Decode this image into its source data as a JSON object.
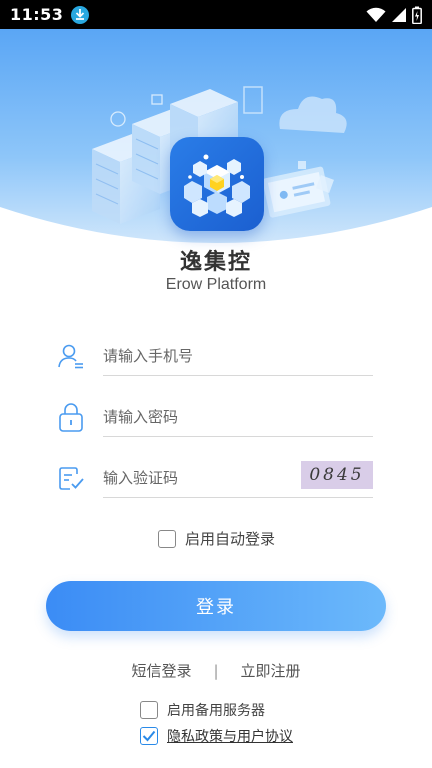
{
  "status_bar": {
    "time": "11:53"
  },
  "app": {
    "title": "逸集控",
    "subtitle": "Erow Platform"
  },
  "form": {
    "phone_placeholder": "请输入手机号",
    "password_placeholder": "请输入密码",
    "code_placeholder": "输入验证码",
    "captcha_text": "0845",
    "auto_login_label": "启用自动登录",
    "auto_login_checked": false
  },
  "login_button": "登录",
  "links": {
    "sms_login": "短信登录",
    "separator": "|",
    "register": "立即注册"
  },
  "options": {
    "backup_server_label": "启用备用服务器",
    "backup_server_checked": false,
    "privacy_label": "隐私政策与用户协议",
    "privacy_checked": true
  },
  "colors": {
    "accent": "#3b8cf5",
    "accent_light": "#6cb9fb",
    "hero_top": "#5ea9f6",
    "hero_bottom": "#cfe6fb"
  }
}
